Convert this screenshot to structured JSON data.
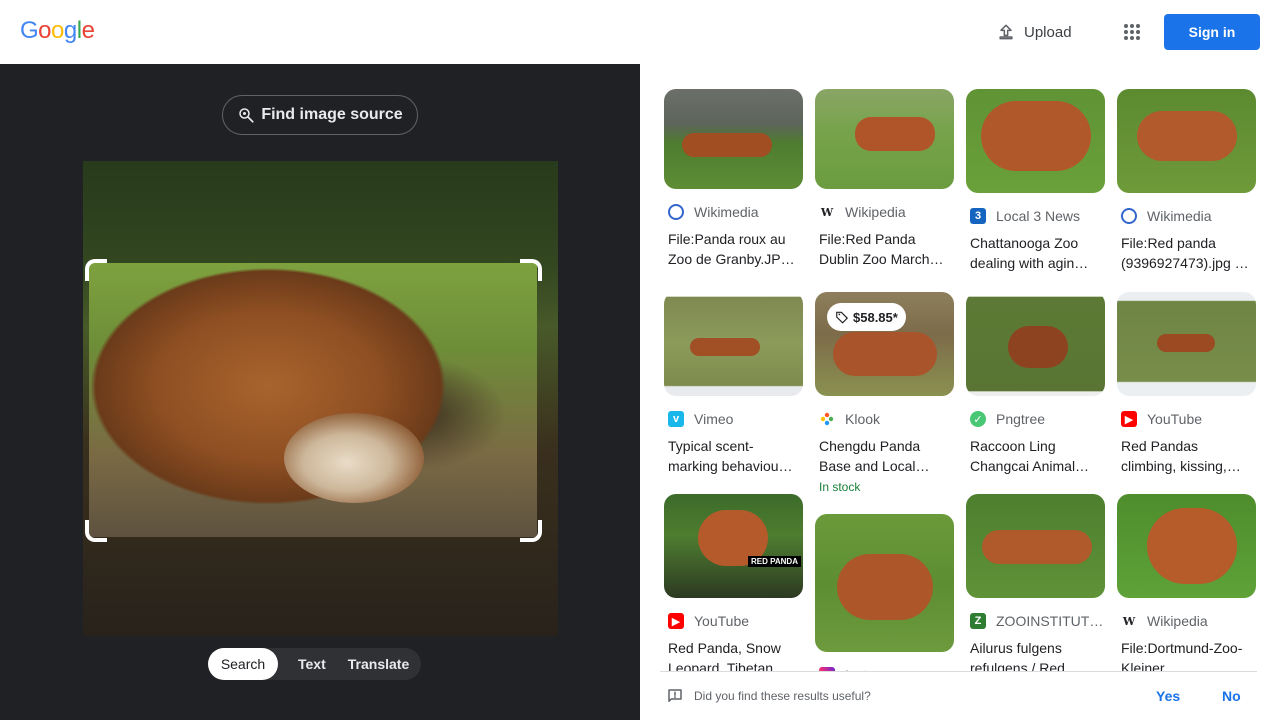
{
  "header": {
    "logo_letters": [
      "G",
      "o",
      "o",
      "g",
      "l",
      "e"
    ],
    "upload_label": "Upload",
    "apps_icon": "apps-grid-icon",
    "signin_label": "Sign in"
  },
  "lens": {
    "find_source_label": "Find image source",
    "modes": [
      "Search",
      "Text",
      "Translate"
    ],
    "active_mode": "Search"
  },
  "results": [
    {
      "source": "Wikimedia",
      "title": "File:Panda roux au Zoo de Granby.JP…",
      "icon": "wikimedia-icon"
    },
    {
      "source": "Wikipedia",
      "title": "File:Red Panda Dublin Zoo March…",
      "icon": "wikipedia-icon"
    },
    {
      "source": "Local 3 News",
      "title": "Chattanooga Zoo dealing with agin…",
      "icon": "local3-icon"
    },
    {
      "source": "Wikimedia",
      "title": "File:Red panda (9396927473).jpg …",
      "icon": "wikimedia-icon"
    },
    {
      "source": "Vimeo",
      "title": "Typical scent-marking behaviou…",
      "icon": "vimeo-icon"
    },
    {
      "source": "Klook",
      "title": "Chengdu Panda Base and Local…",
      "icon": "klook-icon",
      "price": "$58.85*",
      "stock": "In stock"
    },
    {
      "source": "Pngtree",
      "title": "Raccoon Ling Changcai Animal…",
      "icon": "pngtree-icon"
    },
    {
      "source": "YouTube",
      "title": "Red Pandas climbing, kissing,…",
      "icon": "youtube-icon"
    },
    {
      "source": "YouTube",
      "title": "Red Panda, Snow Leopard, Tibetan…",
      "icon": "youtube-icon",
      "overlay_text": "RED PANDA"
    },
    {
      "source": "Instagram",
      "title": "",
      "icon": "instagram-icon"
    },
    {
      "source": "ZOOINSTITUT…",
      "title": "Ailurus fulgens refulgens / Red…",
      "icon": "zooinstitut-icon"
    },
    {
      "source": "Wikipedia",
      "title": "File:Dortmund-Zoo-Kleiner…",
      "icon": "wikipedia-icon"
    }
  ],
  "feedback": {
    "question": "Did you find these results useful?",
    "yes": "Yes",
    "no": "No"
  },
  "colors": {
    "accent": "#1a73e8",
    "panel_dark": "#202124",
    "stock_green": "#188038"
  }
}
